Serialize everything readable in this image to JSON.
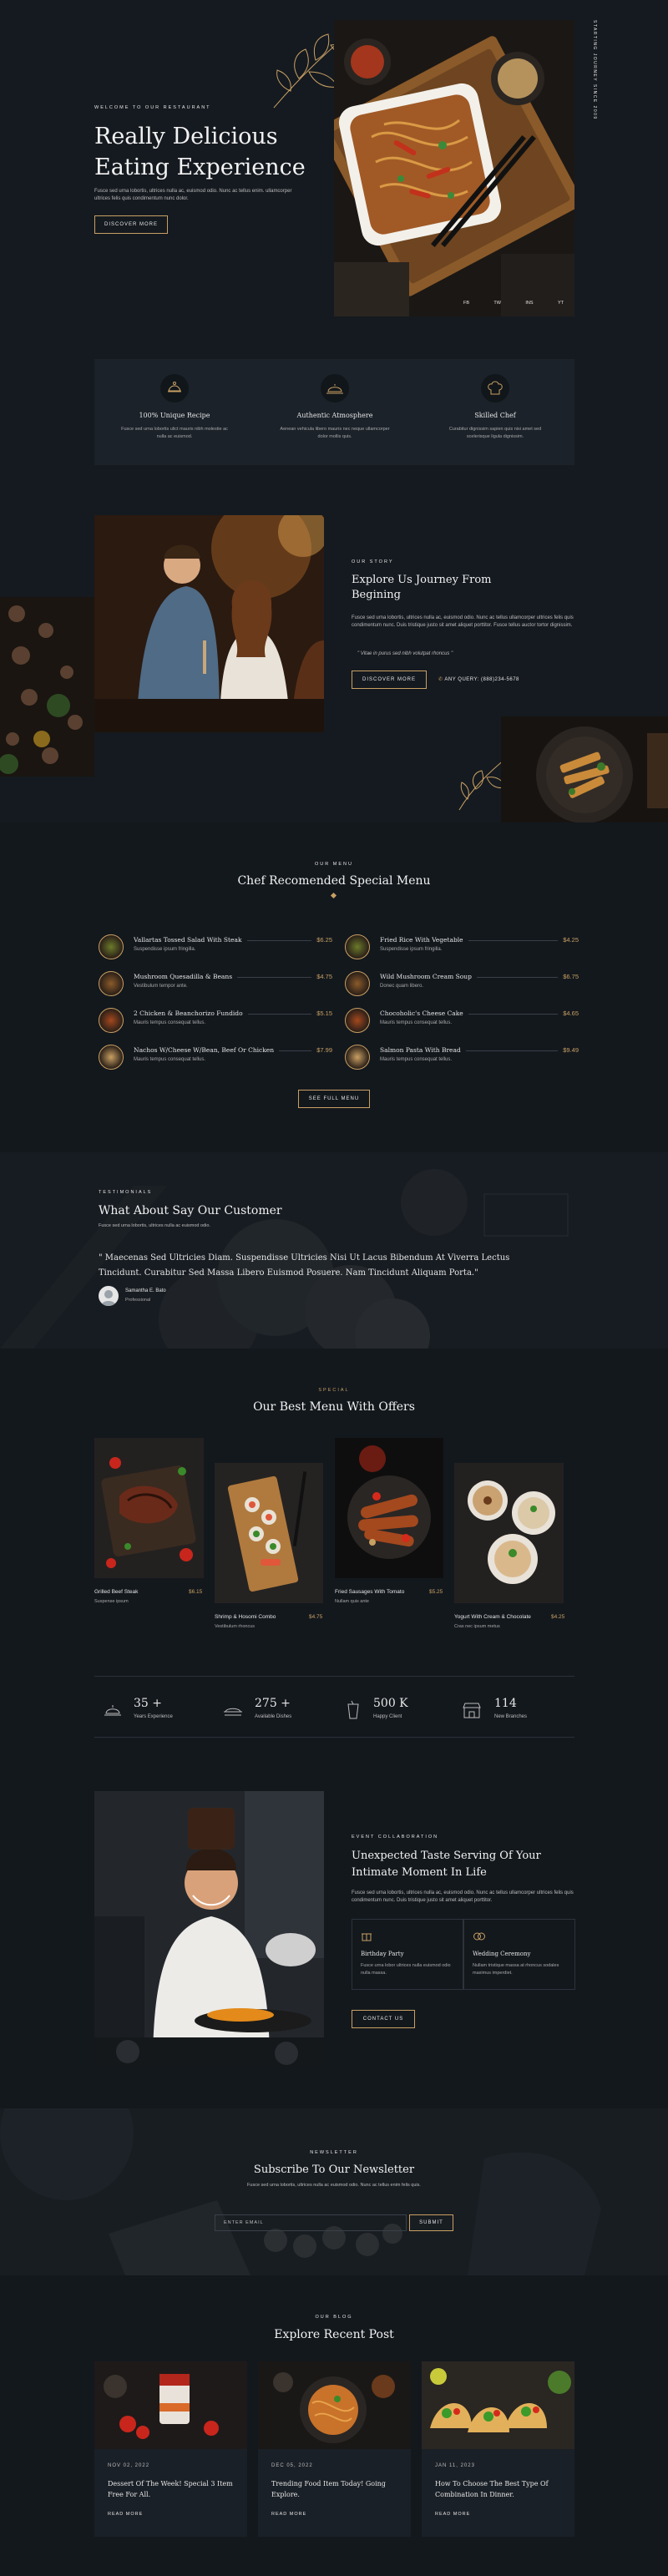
{
  "hero": {
    "eyebrow": "WELCOME TO OUR RESTAURANT",
    "title_line1": "Really Delicious",
    "title_line2": "Eating Experience",
    "desc": "Fusce sed urna lobortis, ultrices nulla ac, euismod odio. Nunc ac tellus enim. ullamcorper ultrices felis quis condimentum nunc dolor.",
    "button": "DISCOVER MORE",
    "vertical_text": "STARTING JOURNEY SINCE 2009",
    "socials": [
      "FB",
      "TW",
      "INS",
      "YT"
    ]
  },
  "features": [
    {
      "icon": "recipe-icon",
      "title": "100% Unique Recipe",
      "desc": "Fusce sed urna lobortis ulict mauris nibh molestie ac nulla ac euismod."
    },
    {
      "icon": "cloche-icon",
      "title": "Authentic Atmosphere",
      "desc": "Aenean vehicula libero mauris nec neque ullamcorper dolor mollis quis."
    },
    {
      "icon": "chef-hat-icon",
      "title": "Skilled Chef",
      "desc": "Curabitur dignissim sapien quis nisi amet sed scelerisque ligula dignissim."
    }
  ],
  "story": {
    "eyebrow": "OUR STORY",
    "title_line1": "Explore Us Journey From",
    "title_line2": "Begining",
    "desc": "Fusce sed urna lobortis, ultrices nulla ac, euismod odio. Nunc ac tellus ullamcorper ultrices felis quis condimentum nunc. Duis tristique justo sit amet aliquet porttitor. Fusce tellus auctor tortor dignissim.",
    "quote": "\" Vitae in purus sed nibh volutpat rhoncus \"",
    "button": "DISCOVER MORE",
    "phone": "ANY QUERY: (888)234-5678"
  },
  "menu": {
    "eyebrow": "OUR MENU",
    "title": "Chef Recomended Special Menu",
    "left": [
      {
        "name": "Vallartas Tossed Salad With Steak",
        "desc": "Suspendisse ipsum fringilla.",
        "price": "$6.25"
      },
      {
        "name": "Mushroom Quesadilla & Beans",
        "desc": "Vestibulum tempor ante.",
        "price": "$4.75"
      },
      {
        "name": "2 Chicken & Beanchorizo Fundido",
        "desc": "Mauris tempus consequat tellus.",
        "price": "$5.15"
      },
      {
        "name": "Nachos W/Cheese W/Bean, Beef Or Chicken",
        "desc": "Mauris tempus consequat tellus.",
        "price": "$7.99"
      }
    ],
    "right": [
      {
        "name": "Fried Rice With Vegetable",
        "desc": "Suspendisse ipsum fringilla.",
        "price": "$4.25"
      },
      {
        "name": "Wild Mushroom Cream Soup",
        "desc": "Donec quam libero.",
        "price": "$6.75"
      },
      {
        "name": "Chocoholic's Cheese Cake",
        "desc": "Mauris tempus consequat tellus.",
        "price": "$4.65"
      },
      {
        "name": "Salmon Pasta With Bread",
        "desc": "Mauris tempus consequat tellus.",
        "price": "$9.49"
      }
    ],
    "button": "SEE FULL MENU"
  },
  "testimonial": {
    "eyebrow": "TESTIMONIALS",
    "title": "What About Say Our Customer",
    "desc": "Fusce sed urna lobortis, ultrices nulla ac euismod odio.",
    "quote": "\" Maecenas Sed Ultricies Diam. Suspendisse Ultricies Nisi Ut Lacus Bibendum At Viverra Lectus Tincidunt. Curabitur Sed Massa Libero Euismod Posuere. Nam Tincidunt Aliquam Porta.\"",
    "author": "Samantha E. Bato",
    "role": "Professional"
  },
  "offers": {
    "eyebrow": "SPECIAL",
    "title": "Our Best Menu With Offers",
    "items": [
      {
        "name": "Grilled Beef Steak",
        "sub": "Suspense ipsum",
        "price": "$6.15"
      },
      {
        "name": "Shrimp & Hosomi Combo",
        "sub": "Vestibulum rhoncus",
        "price": "$4.75"
      },
      {
        "name": "Fried Sausages With Tomato",
        "sub": "Nullam quis ante",
        "price": "$5.25"
      },
      {
        "name": "Yogurt With Cream & Chocolate",
        "sub": "Cras nec ipsum metus",
        "price": "$4.25"
      }
    ]
  },
  "stats": [
    {
      "icon": "cloche-icon",
      "num": "35 +",
      "label": "Years Experience"
    },
    {
      "icon": "dish-icon",
      "num": "275 +",
      "label": "Available Dishes"
    },
    {
      "icon": "drink-icon",
      "num": "500 K",
      "label": "Happy Client"
    },
    {
      "icon": "store-icon",
      "num": "114",
      "label": "New Branches"
    }
  ],
  "event": {
    "eyebrow": "EVENT COLLABORATION",
    "title_line1": "Unexpected Taste Serving Of Your",
    "title_line2": "Intimate Moment In Life",
    "desc": "Fusce sed urna lobortis, ultrices nulla ac, euismod odio. Nunc ac tellus ullamcorper ultrices felis quis condimentum nunc. Duis tristique justo sit amet aliquet porttitor.",
    "cards": [
      {
        "icon": "gift-icon",
        "title": "Birthday Party",
        "desc": "Fusce urna lobor ultrices nulla euismod odio nulla massa."
      },
      {
        "icon": "rings-icon",
        "title": "Wedding Ceremony",
        "desc": "Nullam tristique massa at rhoncus sodales maximus imperdiet."
      }
    ],
    "button": "CONTACT US"
  },
  "newsletter": {
    "eyebrow": "NEWSLETTER",
    "title": "Subscribe To Our Newsletter",
    "desc": "Fusce sed urna lobortis, ultrices nulla ac euismod odio. Nunc ac tellus enim felis quis.",
    "placeholder": "ENTER EMAIL",
    "button": "SUBMIT"
  },
  "blog": {
    "eyebrow": "OUR BLOG",
    "title": "Explore Recent Post",
    "posts": [
      {
        "date": "NOV 02, 2022",
        "title": "Dessert Of The Week! Special 3 Item Free For All.",
        "read": "READ MORE"
      },
      {
        "date": "DEC 05, 2022",
        "title": "Trending Food Item Today! Going Explore.",
        "read": "READ MORE"
      },
      {
        "date": "JAN 11, 2023",
        "title": "How To Choose The Best Type Of Combination In Dinner.",
        "read": "READ MORE"
      }
    ]
  },
  "colors": {
    "accent": "#c9a063",
    "background": "#11161b",
    "panel": "#1a2027"
  }
}
